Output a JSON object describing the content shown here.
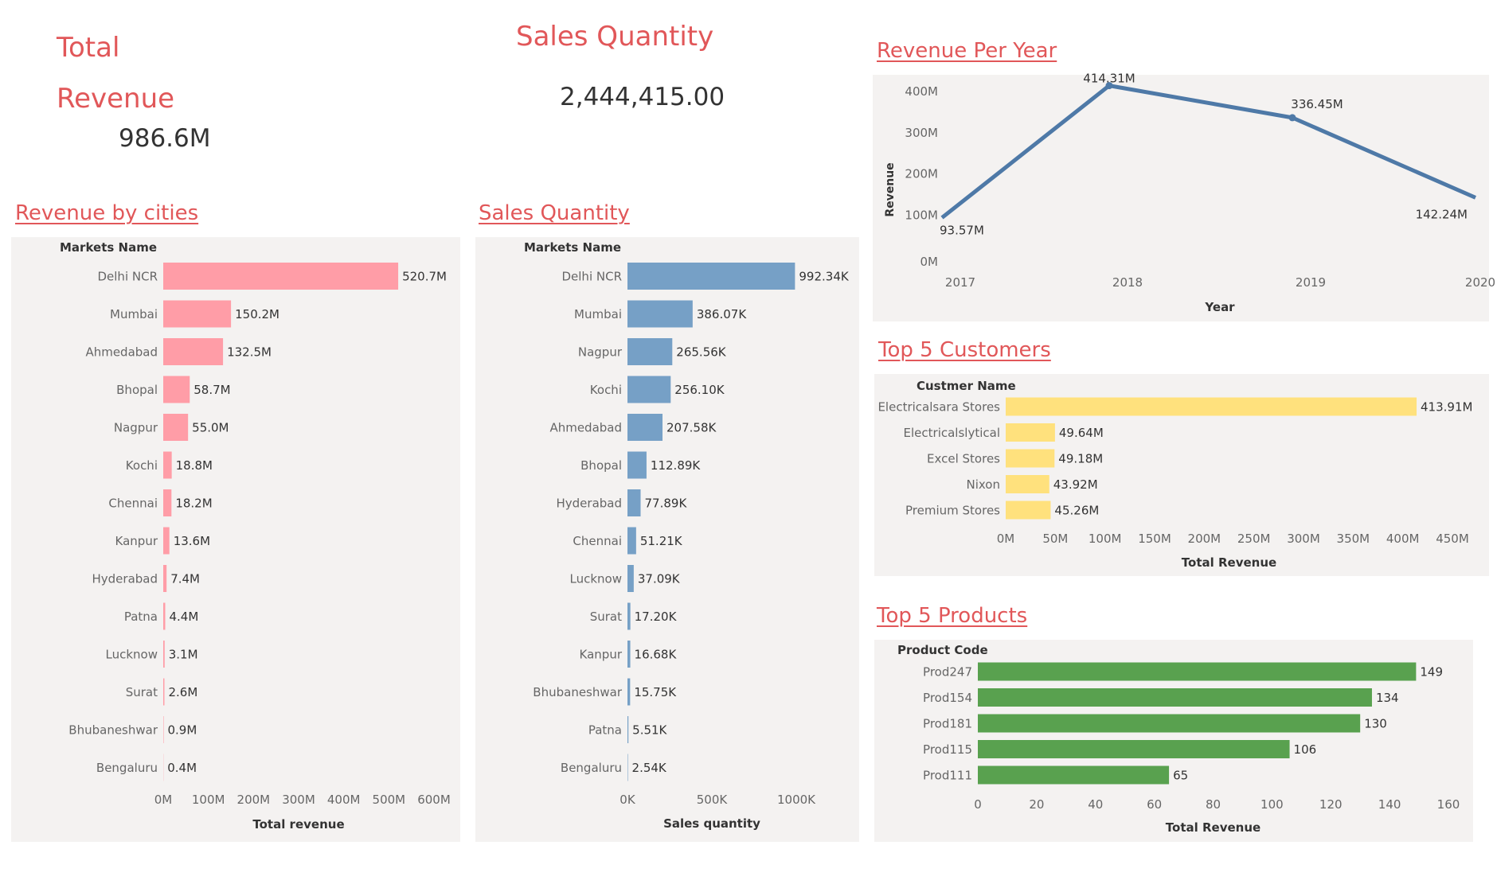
{
  "kpis": {
    "total_revenue_title": "Total Revenue",
    "total_revenue_value": "986.6M",
    "sales_quantity_title": "Sales Quantity",
    "sales_quantity_value": "2,444,415.00"
  },
  "sections": {
    "revenue_by_cities": "Revenue by cities",
    "sales_quantity": "Sales Quantity",
    "revenue_per_year": "Revenue Per Year",
    "top5_customers": "Top 5 Customers",
    "top5_products": "Top 5 Products"
  },
  "colors": {
    "title": "#e15759",
    "panel_bg": "#f4f2f1",
    "cities_bar": "#ff9da7",
    "quantity_bar": "#76a0c6",
    "line": "#4e79a7",
    "customers_bar": "#ffe17d",
    "products_bar": "#59a14f"
  },
  "chart_data": [
    {
      "id": "cities",
      "type": "bar",
      "orientation": "horizontal",
      "header": "Markets Name",
      "xlabel": "Total revenue",
      "xlim": [
        0,
        600
      ],
      "ticks": [
        "0M",
        "100M",
        "200M",
        "300M",
        "400M",
        "500M",
        "600M"
      ],
      "categories": [
        "Delhi NCR",
        "Mumbai",
        "Ahmedabad",
        "Bhopal",
        "Nagpur",
        "Kochi",
        "Chennai",
        "Kanpur",
        "Hyderabad",
        "Patna",
        "Lucknow",
        "Surat",
        "Bhubaneshwar",
        "Bengaluru"
      ],
      "values": [
        520.7,
        150.2,
        132.5,
        58.7,
        55.0,
        18.8,
        18.2,
        13.6,
        7.4,
        4.4,
        3.1,
        2.6,
        0.9,
        0.4
      ],
      "labels": [
        "520.7M",
        "150.2M",
        "132.5M",
        "58.7M",
        "55.0M",
        "18.8M",
        "18.2M",
        "13.6M",
        "7.4M",
        "4.4M",
        "3.1M",
        "2.6M",
        "0.9M",
        "0.4M"
      ]
    },
    {
      "id": "quantity",
      "type": "bar",
      "orientation": "horizontal",
      "header": "Markets Name",
      "xlabel": "Sales quantity",
      "xlim": [
        0,
        1000
      ],
      "ticks": [
        "0K",
        "500K",
        "1000K"
      ],
      "categories": [
        "Delhi NCR",
        "Mumbai",
        "Nagpur",
        "Kochi",
        "Ahmedabad",
        "Bhopal",
        "Hyderabad",
        "Chennai",
        "Lucknow",
        "Surat",
        "Kanpur",
        "Bhubaneshwar",
        "Patna",
        "Bengaluru"
      ],
      "values": [
        992.34,
        386.07,
        265.56,
        256.1,
        207.58,
        112.89,
        77.89,
        51.21,
        37.09,
        17.2,
        16.68,
        15.75,
        5.51,
        2.54
      ],
      "labels": [
        "992.34K",
        "386.07K",
        "265.56K",
        "256.10K",
        "207.58K",
        "112.89K",
        "77.89K",
        "51.21K",
        "37.09K",
        "17.20K",
        "16.68K",
        "15.75K",
        "5.51K",
        "2.54K"
      ]
    },
    {
      "id": "years",
      "type": "line",
      "xlabel": "Year",
      "ylabel": "Revenue",
      "ylim": [
        0,
        400
      ],
      "yticks": [
        "0M",
        "100M",
        "200M",
        "300M",
        "400M"
      ],
      "x": [
        "2017",
        "2018",
        "2019",
        "2020"
      ],
      "values": [
        93.57,
        414.31,
        336.45,
        142.24
      ],
      "labels": [
        "93.57M",
        "414.31M",
        "336.45M",
        "142.24M"
      ]
    },
    {
      "id": "customers",
      "type": "bar",
      "orientation": "horizontal",
      "header": "Custmer Name",
      "xlabel": "Total Revenue",
      "xlim": [
        0,
        450
      ],
      "ticks": [
        "0M",
        "50M",
        "100M",
        "150M",
        "200M",
        "250M",
        "300M",
        "350M",
        "400M",
        "450M"
      ],
      "categories": [
        "Electricalsara Stores",
        "Electricalslytical",
        "Excel Stores",
        "Nixon",
        "Premium Stores"
      ],
      "values": [
        413.91,
        49.64,
        49.18,
        43.92,
        45.26
      ],
      "labels": [
        "413.91M",
        "49.64M",
        "49.18M",
        "43.92M",
        "45.26M"
      ]
    },
    {
      "id": "products",
      "type": "bar",
      "orientation": "horizontal",
      "header": "Product Code",
      "xlabel": "Total Revenue",
      "xlim": [
        0,
        160
      ],
      "ticks": [
        "0",
        "20",
        "40",
        "60",
        "80",
        "100",
        "120",
        "140",
        "160"
      ],
      "categories": [
        "Prod247",
        "Prod154",
        "Prod181",
        "Prod115",
        "Prod111"
      ],
      "values": [
        149,
        134,
        130,
        106,
        65
      ],
      "labels": [
        "149",
        "134",
        "130",
        "106",
        "65"
      ]
    }
  ]
}
